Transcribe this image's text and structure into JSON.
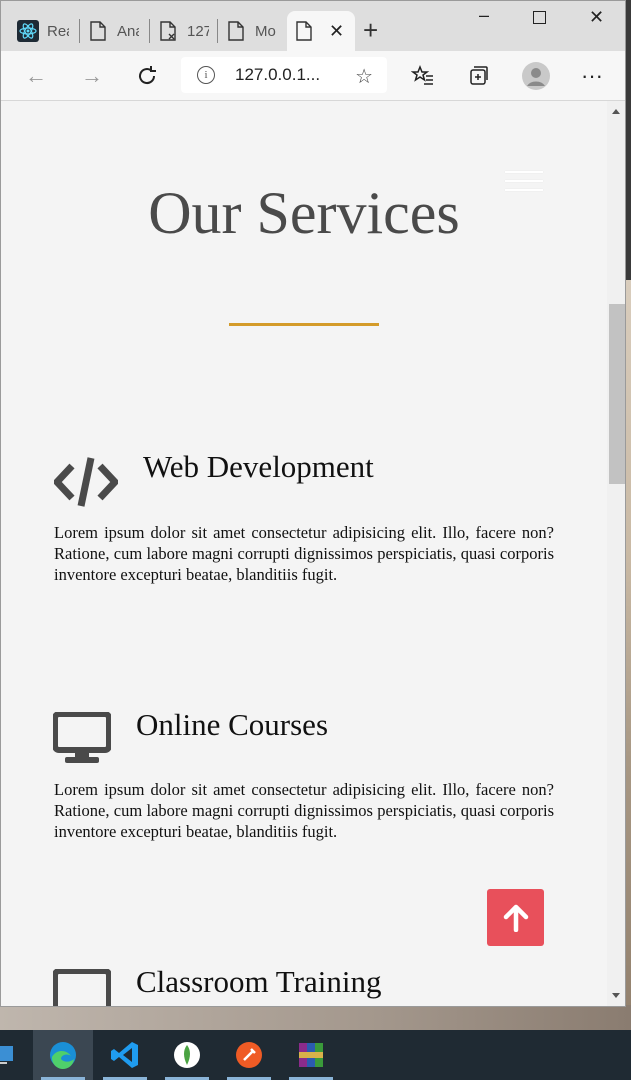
{
  "tabs": [
    {
      "label": "Rea",
      "icon": "react-icon"
    },
    {
      "label": "Ana",
      "icon": "page-icon"
    },
    {
      "label": "127",
      "icon": "error-page-icon"
    },
    {
      "label": "Mo",
      "icon": "page-icon"
    },
    {
      "label": "",
      "icon": "page-icon",
      "active": true
    }
  ],
  "toolbar": {
    "url": "127.0.0.1..."
  },
  "page": {
    "section_title": "Our Services",
    "services": [
      {
        "title": "Web Development",
        "icon": "code-icon",
        "description": "Lorem ipsum dolor sit amet consectetur adipisicing elit. Illo, facere non? Ratione, cum labore magni corrupti dignissimos perspiciatis, quasi corporis inventore excepturi beatae, blanditiis fugit."
      },
      {
        "title": "Online Courses",
        "icon": "desktop-icon",
        "description": "Lorem ipsum dolor sit amet consectetur adipisicing elit. Illo, facere non? Ratione, cum labore magni corrupti dignissimos perspiciatis, quasi corporis inventore excepturi beatae, blanditiis fugit."
      },
      {
        "title": "Classroom Training",
        "icon": "classroom-icon"
      }
    ]
  },
  "colors": {
    "accent_rule": "#d49b2a",
    "scroll_top_button": "#e8505b",
    "text": "#4a4a4a"
  },
  "taskbar": {
    "apps": [
      "desktop-icon",
      "edge-icon",
      "vscode-icon",
      "mongodb-icon",
      "postman-icon",
      "winrar-icon"
    ]
  }
}
